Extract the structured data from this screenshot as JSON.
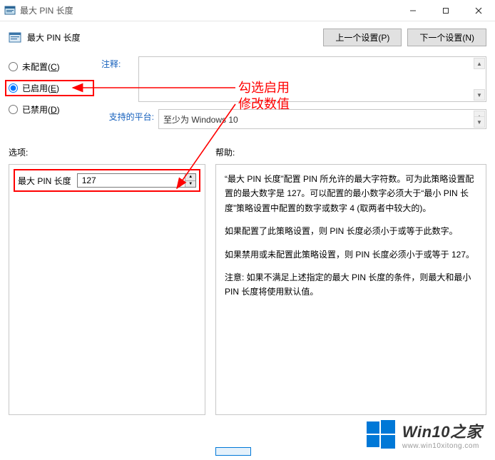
{
  "window": {
    "title": "最大 PIN 长度"
  },
  "header": {
    "title": "最大 PIN 长度",
    "prev_button": "上一个设置(P)",
    "next_button": "下一个设置(N)"
  },
  "radios": {
    "not_configured": "未配置(",
    "not_configured_key": "C",
    "not_configured_suffix": ")",
    "enabled": "已启用(",
    "enabled_key": "E",
    "enabled_suffix": ")",
    "disabled": "已禁用(",
    "disabled_key": "D",
    "disabled_suffix": ")",
    "selected": "enabled"
  },
  "labels": {
    "comment": "注释:",
    "platform": "支持的平台:",
    "options": "选项:",
    "help": "帮助:"
  },
  "platform_value": "至少为 Windows 10",
  "option": {
    "label": "最大 PIN 长度",
    "value": "127"
  },
  "help": {
    "p1": "“最大 PIN 长度”配置 PIN 所允许的最大字符数。可为此策略设置配置的最大数字是 127。可以配置的最小数字必须大于“最小 PIN 长度”策略设置中配置的数字或数字 4 (取两者中较大的)。",
    "p2": "如果配置了此策略设置，则 PIN 长度必须小于或等于此数字。",
    "p3": "如果禁用或未配置此策略设置，则 PIN 长度必须小于或等于 127。",
    "p4": "注意: 如果不满足上述指定的最大 PIN 长度的条件，则最大和最小 PIN 长度将使用默认值。"
  },
  "annotation": {
    "line1": "勾选启用",
    "line2": "修改数值"
  },
  "watermark": {
    "title": "Win10之家",
    "sub": "www.win10xitong.com"
  }
}
